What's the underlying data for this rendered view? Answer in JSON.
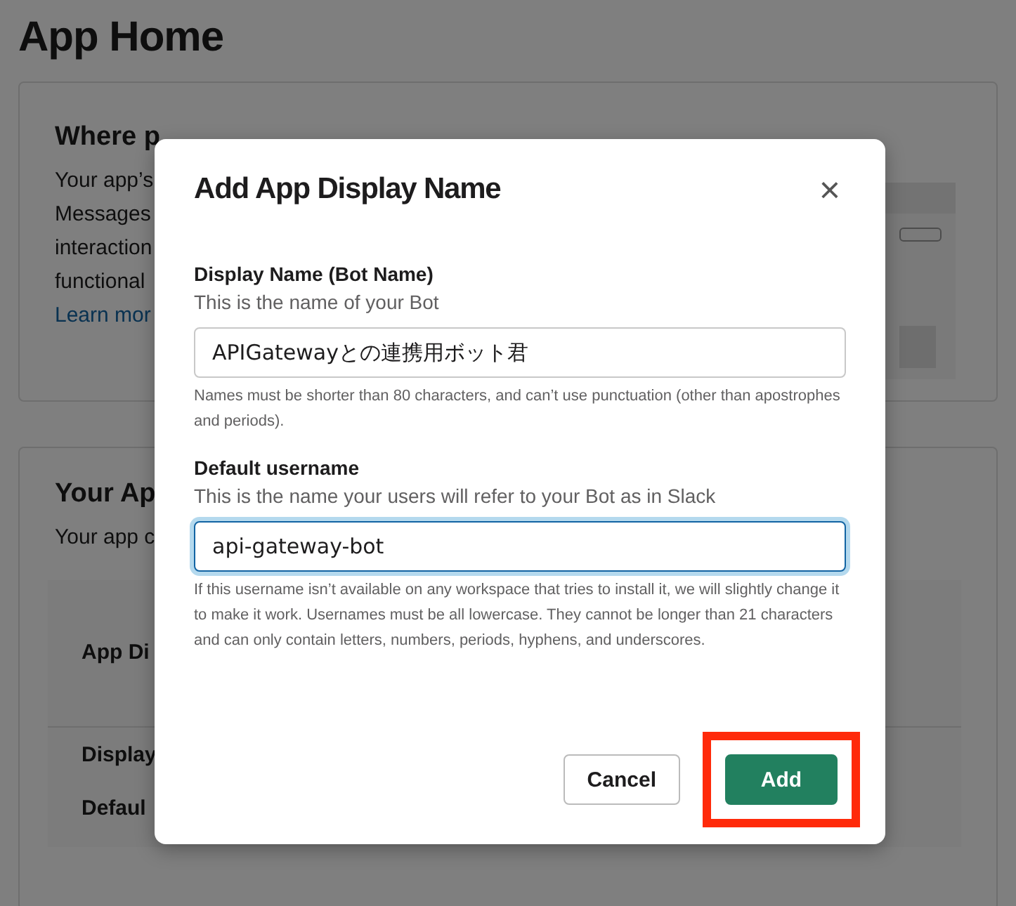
{
  "page": {
    "title": "App Home",
    "cards": [
      {
        "heading": "Where p",
        "lines": [
          "Your app’s",
          "Messages",
          "interaction",
          "functional"
        ],
        "link": "Learn mor"
      },
      {
        "heading": "Your Ap",
        "lines": [
          "Your app c"
        ],
        "rows": [
          "App Di",
          "Display",
          "Defaul"
        ]
      }
    ]
  },
  "dialog": {
    "title": "Add App Display Name",
    "close": "×",
    "fields": [
      {
        "label": "Display Name (Bot Name)",
        "description": "This is the name of your Bot",
        "value": "APIGatewayとの連携用ボット君",
        "focused": false,
        "hint": "Names must be shorter than 80 characters, and can’t use punctuation (other than apostrophes and periods)."
      },
      {
        "label": "Default username",
        "description": "This is the name your users will refer to your Bot as in Slack",
        "value": "api-gateway-bot",
        "focused": true,
        "hint": "If this username isn’t available on any workspace that tries to install it, we will slightly change it to make it work. Usernames must be all lowercase. They cannot be longer than 21 characters and can only contain letters, numbers, periods, hyphens, and underscores."
      }
    ],
    "buttons": [
      {
        "label": "Cancel",
        "kind": "secondary",
        "highlighted": false
      },
      {
        "label": "Add",
        "kind": "primary",
        "highlighted": true
      }
    ]
  }
}
